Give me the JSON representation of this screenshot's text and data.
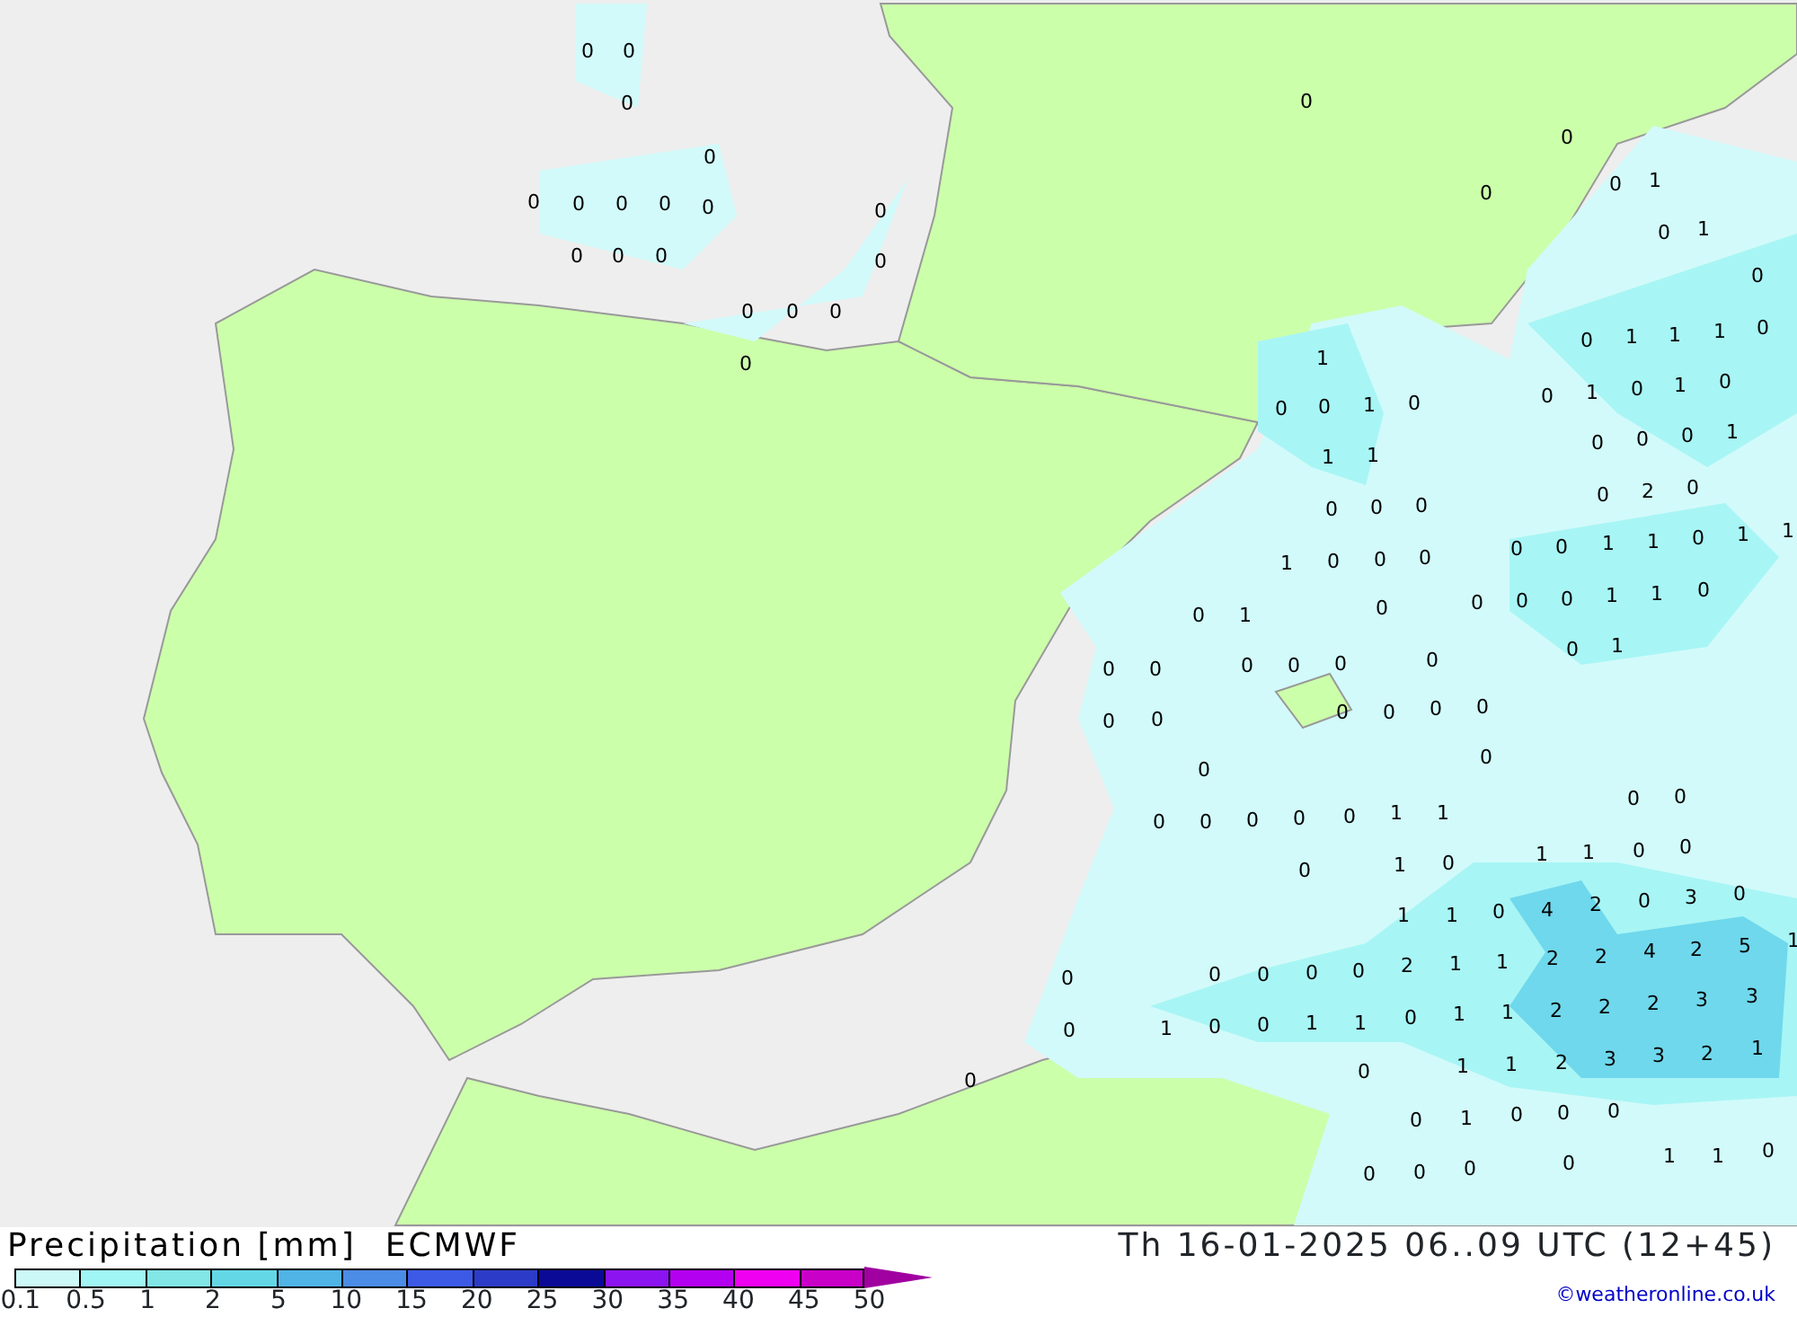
{
  "map": {
    "values": [
      "0",
      "0",
      "0",
      "0",
      "0",
      "0",
      "0",
      "0",
      "0",
      "0",
      "0",
      "0",
      "0",
      "0",
      "0",
      "0",
      "0",
      "0",
      "0",
      "0",
      "0",
      "0",
      "1",
      "0",
      "1",
      "0",
      "0",
      "1",
      "1",
      "1",
      "0",
      "0",
      "1",
      "0",
      "1",
      "0",
      "0",
      "0",
      "0",
      "1",
      "0",
      "2",
      "0",
      "0",
      "0",
      "1",
      "1",
      "0",
      "1",
      "1",
      "0",
      "0",
      "0",
      "1",
      "1",
      "0",
      "0",
      "1",
      "1",
      "0",
      "0",
      "1",
      "0",
      "1",
      "1",
      "0",
      "0",
      "0",
      "1",
      "0",
      "0",
      "0",
      "0",
      "1",
      "0",
      "0",
      "0",
      "0",
      "0",
      "0",
      "0",
      "0",
      "0",
      "0",
      "0",
      "0",
      "0",
      "0",
      "0",
      "0",
      "1",
      "1",
      "1",
      "0",
      "1",
      "1",
      "0",
      "0",
      "0",
      "0",
      "1",
      "1",
      "0",
      "4",
      "2",
      "0",
      "3",
      "0",
      "0",
      "2",
      "1",
      "1",
      "2",
      "2",
      "4",
      "2",
      "5",
      "1",
      "1",
      "0",
      "1",
      "1",
      "2",
      "2",
      "2",
      "3",
      "3",
      "0",
      "1",
      "1",
      "2",
      "3",
      "3",
      "2",
      "1",
      "0",
      "1",
      "0",
      "0",
      "0",
      "0",
      "0",
      "0",
      "0",
      "1",
      "1",
      "0",
      "1",
      "0",
      "0",
      "1",
      "0",
      "0",
      "0",
      "0",
      "0",
      "0",
      "0",
      "0",
      "0",
      "0",
      "0"
    ]
  },
  "footer": {
    "title": "Precipitation [mm]",
    "model": "ECMWF",
    "valid_time": "Th 16-01-2025 06..09 UTC (12+45)",
    "credit": "©weatheronline.co.uk",
    "legend": [
      {
        "label": "0.1",
        "color": "#ccf8f8"
      },
      {
        "label": "0.5",
        "color": "#a0f5f5"
      },
      {
        "label": "1",
        "color": "#82e6e6"
      },
      {
        "label": "2",
        "color": "#64d7e6"
      },
      {
        "label": "5",
        "color": "#50b4e6"
      },
      {
        "label": "10",
        "color": "#4b8ce6"
      },
      {
        "label": "15",
        "color": "#3c5ae6"
      },
      {
        "label": "20",
        "color": "#2d3cc8"
      },
      {
        "label": "25",
        "color": "#0a0a96"
      },
      {
        "label": "30",
        "color": "#8c14f0"
      },
      {
        "label": "35",
        "color": "#b400f0"
      },
      {
        "label": "40",
        "color": "#f000f0"
      },
      {
        "label": "45",
        "color": "#c800c8"
      },
      {
        "label": "50",
        "color": "#a000a0"
      }
    ]
  }
}
